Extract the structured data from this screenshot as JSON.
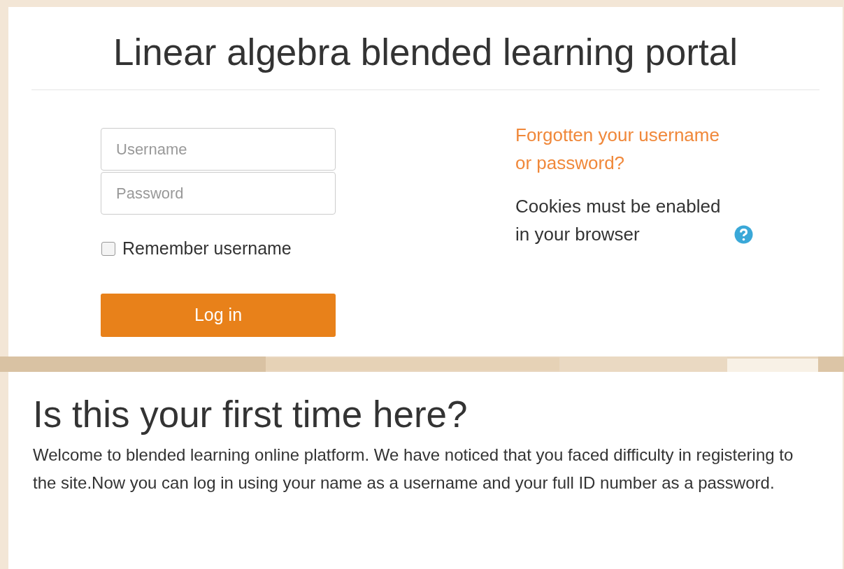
{
  "site_title": "Linear algebra blended learning portal",
  "login": {
    "username": {
      "placeholder": "Username"
    },
    "password": {
      "placeholder": "Password"
    },
    "remember": {
      "label": "Remember username",
      "checked": false
    },
    "button": "Log in",
    "forgot_link": "Forgotten your username or password?",
    "cookies_notice": "Cookies must be enabled in your browser"
  },
  "first_time": {
    "heading": "Is this your first time here?",
    "text": "Welcome to blended learning online platform. We have noticed that you faced difficulty in registering to the site.Now you can log in using your name as a username and your full ID number as a password."
  }
}
